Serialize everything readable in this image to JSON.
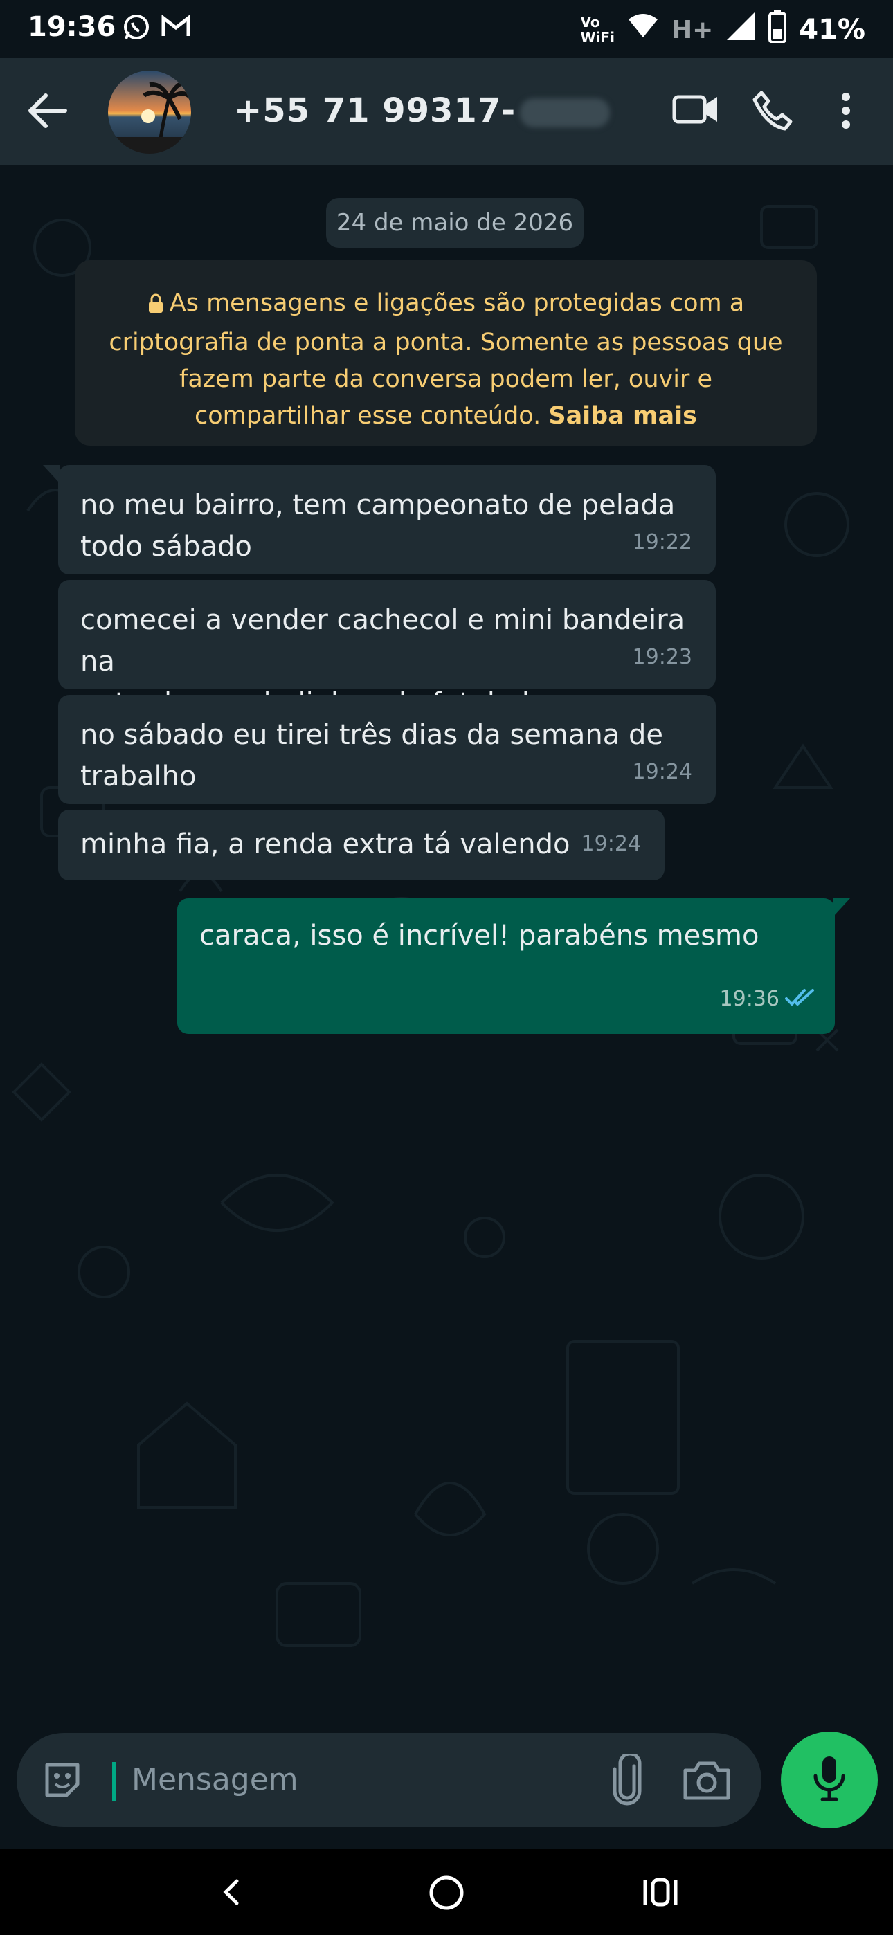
{
  "status_bar": {
    "time": "19:36",
    "network_label_top": "Vo",
    "network_label_bottom": "WiFi",
    "network_type": "H+",
    "battery": "41%",
    "icons": [
      "whatsapp-notification-icon",
      "gmail-notification-icon",
      "wifi-icon",
      "signal-icon",
      "battery-icon"
    ]
  },
  "header": {
    "contact": "+55 71 99317-",
    "icons": [
      "back-arrow-icon",
      "video-call-icon",
      "voice-call-icon",
      "more-options-icon"
    ]
  },
  "chat": {
    "date_chip": "24 de maio de 2026",
    "encryption_notice": {
      "text": "As mensagens e ligações são protegidas com a criptografia de ponta a ponta. Somente as pessoas que fazem parte da conversa podem ler, ouvir e compartilhar esse conteúdo.",
      "link": "Saiba mais"
    },
    "messages": [
      {
        "direction": "in",
        "lines": [
          "no meu bairro, tem campeonato de pelada",
          "todo sábado"
        ],
        "time": "19:22"
      },
      {
        "direction": "in",
        "lines": [
          "comecei a vender cachecol e mini bandeira na",
          "entrada e as bolinhas de futebol"
        ],
        "time": "19:23"
      },
      {
        "direction": "in",
        "lines": [
          "no sábado eu tirei três dias da semana de",
          "trabalho"
        ],
        "time": "19:24"
      },
      {
        "direction": "in",
        "lines": [
          "minha fia, a renda extra tá valendo"
        ],
        "time": "19:24"
      },
      {
        "direction": "out",
        "lines": [
          "caraca, isso é incrível! parabéns mesmo"
        ],
        "time": "19:36",
        "status": "read"
      }
    ]
  },
  "composer": {
    "placeholder": "Mensagem",
    "icons": [
      "sticker-icon",
      "attach-clip-icon",
      "camera-icon",
      "microphone-icon"
    ]
  },
  "nav": {
    "icons": [
      "nav-back-icon",
      "nav-home-icon",
      "nav-recents-icon"
    ]
  },
  "colors": {
    "background": "#0b141a",
    "header": "#1f2c33",
    "incoming_bubble": "#1f2c33",
    "outgoing_bubble": "#005c4b",
    "accent_green": "#21c063",
    "notice_text": "#f7cd73",
    "read_tick": "#53bdeb"
  }
}
